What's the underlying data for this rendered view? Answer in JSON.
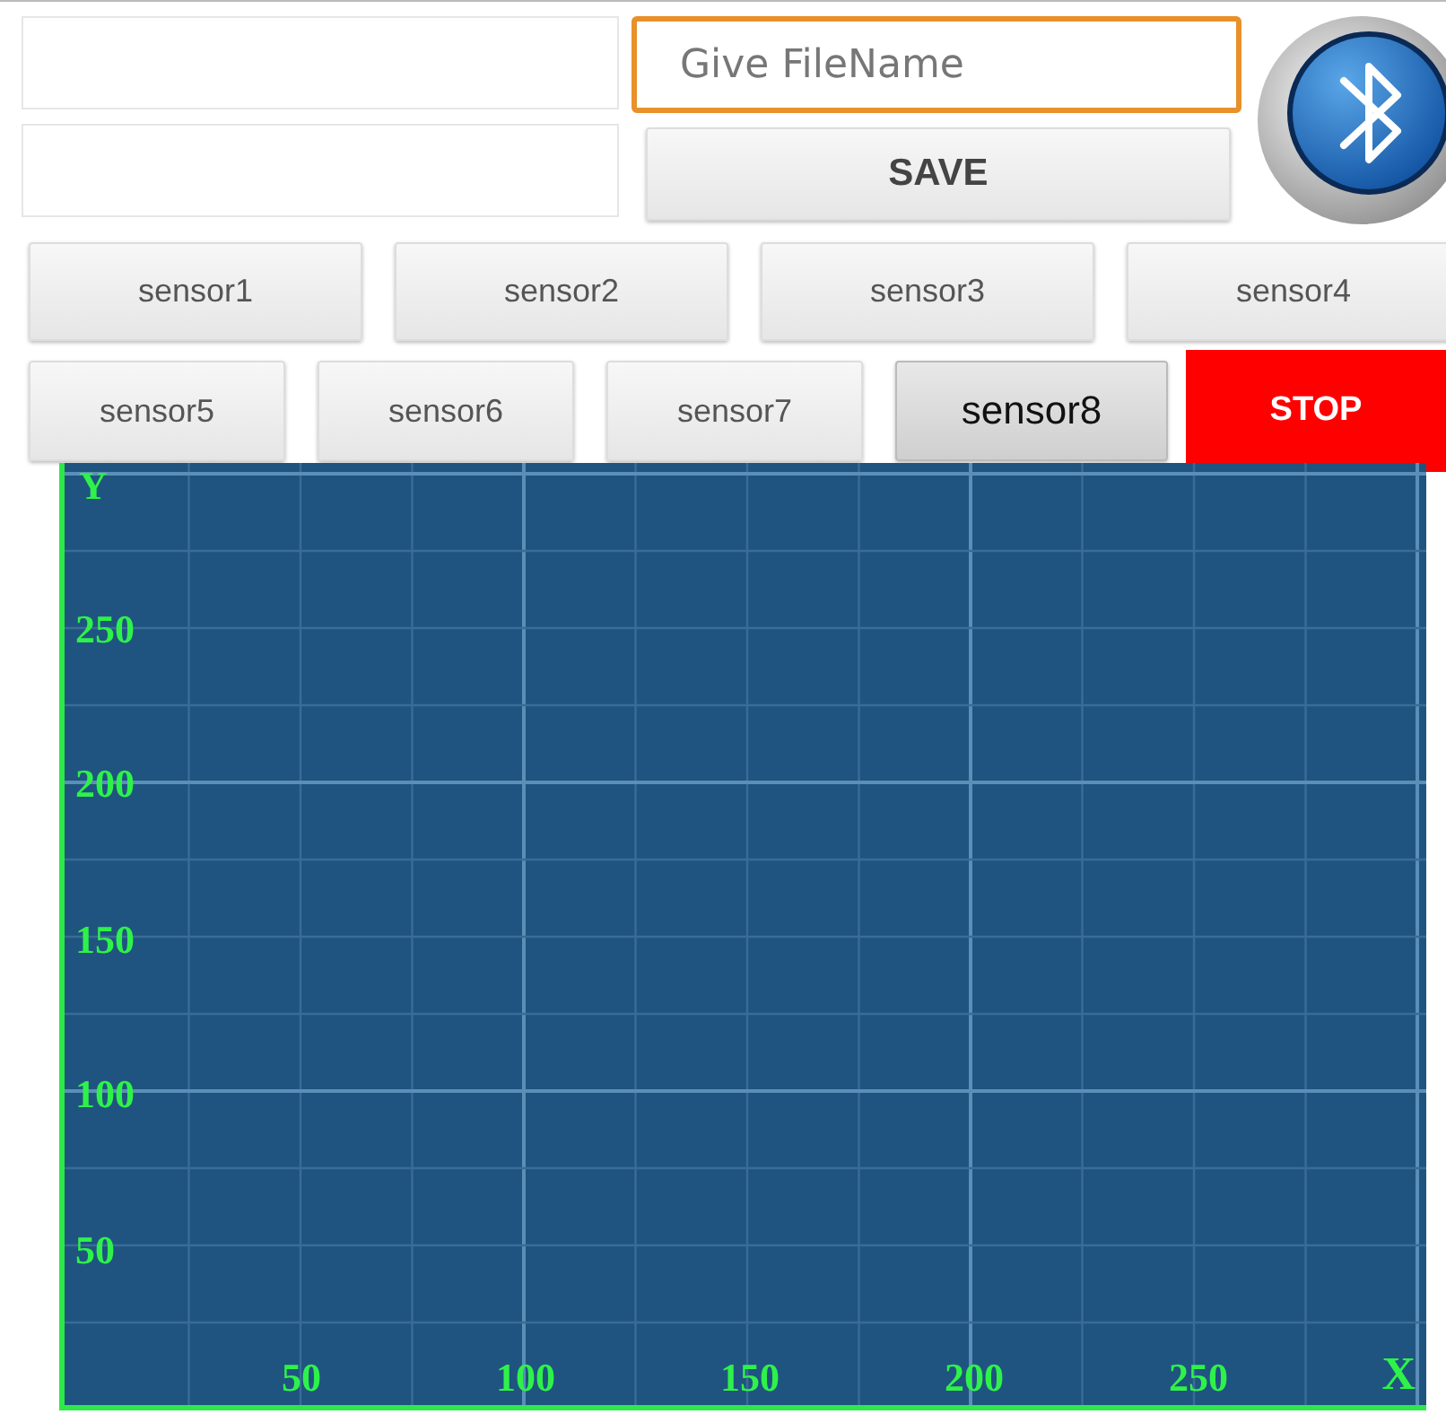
{
  "file_name_field": {
    "placeholder": "Give FileName",
    "focused": true
  },
  "save_button": "SAVE",
  "sensor_buttons": [
    {
      "label": "sensor1",
      "selected": false
    },
    {
      "label": "sensor2",
      "selected": false
    },
    {
      "label": "sensor3",
      "selected": false
    },
    {
      "label": "sensor4",
      "selected": false
    },
    {
      "label": "sensor5",
      "selected": false
    },
    {
      "label": "sensor6",
      "selected": false
    },
    {
      "label": "sensor7",
      "selected": false
    },
    {
      "label": "sensor8",
      "selected": true
    }
  ],
  "stop_button": "STOP",
  "plot": {
    "y_axis_label": "Y",
    "x_axis_label": "X",
    "y_ticks": [
      "250",
      "200",
      "150",
      "100",
      "50"
    ],
    "x_ticks": [
      "50",
      "100",
      "150",
      "200",
      "250"
    ]
  }
}
